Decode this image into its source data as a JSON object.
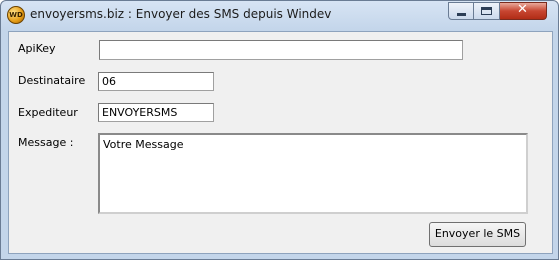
{
  "window": {
    "title": "envoyersms.biz : Envoyer des SMS depuis Windev",
    "app_icon_text": "WD",
    "close_glyph": "✕"
  },
  "form": {
    "apikey_label": "ApiKey",
    "apikey_value": "",
    "destinataire_label": "Destinataire",
    "destinataire_value": "06",
    "expediteur_label": "Expediteur",
    "expediteur_value": "ENVOYERSMS",
    "message_label": "Message :",
    "message_value": "Votre Message",
    "send_button_label": "Envoyer le SMS"
  }
}
